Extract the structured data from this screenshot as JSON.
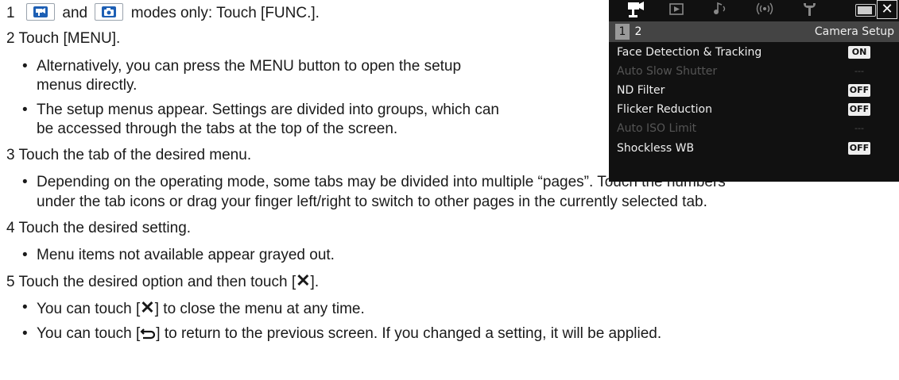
{
  "steps": [
    {
      "num": "1",
      "pre": "",
      "mid": "and",
      "post": "modes only: Touch [FUNC.]."
    },
    {
      "num": "2",
      "text": "Touch [MENU]."
    },
    {
      "num": "3",
      "text": "Touch the tab of the desired menu."
    },
    {
      "num": "4",
      "text": "Touch the desired setting."
    },
    {
      "num": "5",
      "pre": "Touch the desired option and then touch [",
      "post": "]."
    }
  ],
  "bullets": {
    "b1a": "Alternatively, you can press the MENU button to open the setup",
    "b1b": "menus directly.",
    "b2a": "The setup menus appear. Settings are divided into groups, which can",
    "b2b": "be accessed through the tabs at the top of the screen.",
    "b3a": "Depending on the operating mode, some tabs may be divided into multiple “pages”. Touch the numbers",
    "b3b": "under the tab icons or drag your finger left/right to switch to other pages in the currently selected tab.",
    "b4": "Menu items not available appear grayed out.",
    "b5pre": "You can touch [",
    "b5post": "] to close the menu at any time.",
    "b6pre": "You can touch [",
    "b6post": "] to return to the previous screen. If you changed a setting, it will be applied."
  },
  "camera_screen": {
    "close_label": "✕",
    "pages": [
      "1",
      "2"
    ],
    "page_title": "Camera Setup",
    "rows": [
      {
        "label": "Face Detection & Tracking",
        "value": "ON",
        "enabled": true
      },
      {
        "label": "Auto Slow Shutter",
        "value": "---",
        "enabled": false
      },
      {
        "label": "ND Filter",
        "value": "OFF",
        "enabled": true
      },
      {
        "label": "Flicker Reduction",
        "value": "OFF",
        "enabled": true
      },
      {
        "label": "Auto ISO Limit",
        "value": "---",
        "enabled": false
      },
      {
        "label": "Shockless WB",
        "value": "OFF",
        "enabled": true
      }
    ]
  },
  "icons": [
    "video-mode-icon",
    "photo-mode-icon",
    "close-x-icon",
    "return-arrow-icon"
  ]
}
